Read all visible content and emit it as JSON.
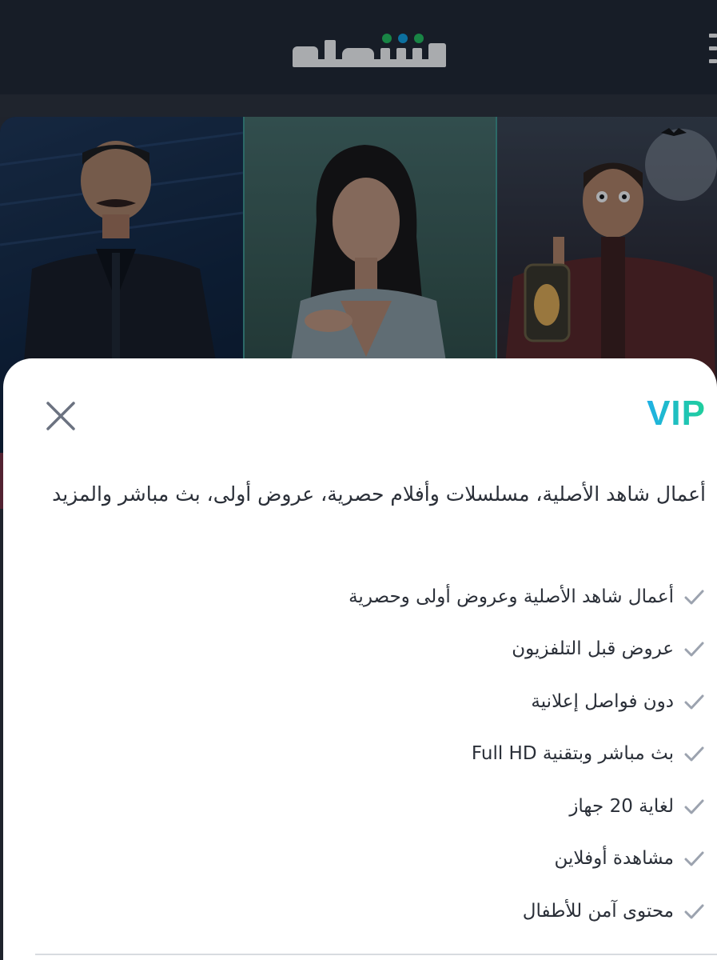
{
  "header": {
    "logo_text": "شاهد",
    "logo_dot_colors": [
      "#22c55e",
      "#0ea5e9",
      "#22c55e"
    ]
  },
  "modal": {
    "title": "VIP",
    "title_gradient": [
      "#1fb0e6",
      "#1fcf9a"
    ],
    "description": "أعمال شاهد الأصلية، مسلسلات وأفلام حصرية، عروض أولى، بث مباشر والمزيد",
    "features": [
      "أعمال شاهد الأصلية وعروض أولى وحصرية",
      "عروض قبل التلفزيون",
      "دون فواصل إعلانية",
      "بث مباشر وبتقنية Full HD",
      "لغاية 20 جهاز",
      "مشاهدة أوفلاين",
      "محتوى آمن للأطفال"
    ]
  },
  "icons": {
    "close": "close-icon",
    "check": "check-icon",
    "menu": "menu-icon"
  }
}
